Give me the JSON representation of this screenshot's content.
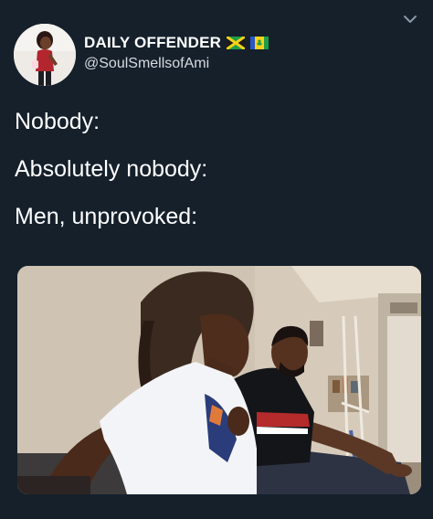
{
  "tweet": {
    "author": {
      "display_name": "DAILY OFFENDER",
      "handle": "@SoulSmellsofAmi",
      "flags": [
        "jamaica-flag-icon",
        "saint-vincent-flag-icon"
      ]
    },
    "text_lines": [
      "Nobody:",
      "Absolutely nobody:",
      "Men, unprovoked:"
    ],
    "menu_icon": "chevron-down-icon",
    "media": {
      "kind": "photo"
    }
  },
  "colors": {
    "background": "#15202b",
    "text": "#ffffff",
    "secondary_text": "#d6dbe0",
    "chevron": "#8899a6"
  }
}
